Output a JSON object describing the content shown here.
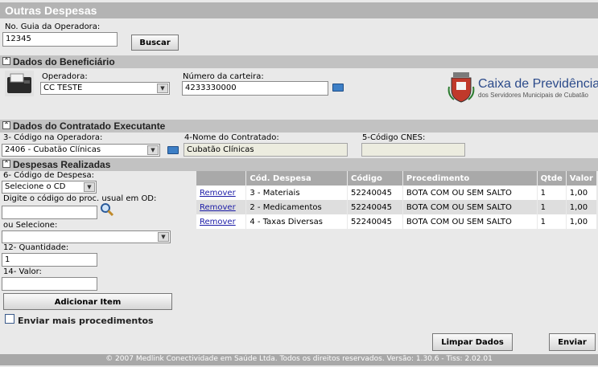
{
  "page": {
    "title": "Outras Despesas"
  },
  "guia": {
    "label": "No. Guia da Operadora:",
    "value": "12345",
    "search_button": "Buscar"
  },
  "beneficiario": {
    "section_title": "Dados do Beneficiário",
    "operadora_label": "Operadora:",
    "operadora_value": "CC TESTE",
    "carteira_label": "Número da carteira:",
    "carteira_value": "4233330000",
    "logo_main": "Caixa de Previdência",
    "logo_sub": "dos Servidores Municipais de Cubatão"
  },
  "contratado": {
    "section_title": "Dados do Contratado Executante",
    "codigo_label": "3- Código na Operadora:",
    "codigo_value": "2406 - Cubatão Clínicas",
    "nome_label": "4-Nome do Contratado:",
    "nome_value": "Cubatão Clínicas",
    "cnes_label": "5-Código CNES:",
    "cnes_value": ""
  },
  "despesas": {
    "section_title": "Despesas Realizadas",
    "codigo_despesa_label": "6- Código de Despesa:",
    "codigo_despesa_value": "Selecione o CD",
    "proc_label": "Digite o código do proc. usual em OD:",
    "proc_value": "",
    "ou_label": "ou Selecione:",
    "ou_value": "",
    "quantidade_label": "12- Quantidade:",
    "quantidade_value": "1",
    "valor_label": "14- Valor:",
    "valor_value": "",
    "add_button": "Adicionar Item",
    "mais_label": "Enviar mais procedimentos",
    "table": {
      "headers": [
        "",
        "Cód. Despesa",
        "Código",
        "Procedimento",
        "Qtde",
        "Valor"
      ],
      "rows": [
        {
          "action": "Remover",
          "cod": "3 - Materiais",
          "codigo": "52240045",
          "proc": "BOTA COM OU SEM SALTO",
          "qtde": "1",
          "valor": "1,00"
        },
        {
          "action": "Remover",
          "cod": "2 - Medicamentos",
          "codigo": "52240045",
          "proc": "BOTA COM OU SEM SALTO",
          "qtde": "1",
          "valor": "1,00"
        },
        {
          "action": "Remover",
          "cod": "4 - Taxas Diversas",
          "codigo": "52240045",
          "proc": "BOTA COM OU SEM SALTO",
          "qtde": "1",
          "valor": "1,00"
        }
      ]
    }
  },
  "actions": {
    "limpar": "Limpar Dados",
    "enviar": "Enviar"
  },
  "footer": {
    "text": "© 2007  Medlink Conectividade em Saúde Ltda.   Todos os direitos reservados.   Versão: 1.30.6 - Tiss: 2.02.01"
  },
  "colors": {
    "title_bg": "#b3b3b3",
    "section_bg": "#c2c2c2",
    "page_bg": "#e9e9e9",
    "link": "#1a1aa6"
  }
}
